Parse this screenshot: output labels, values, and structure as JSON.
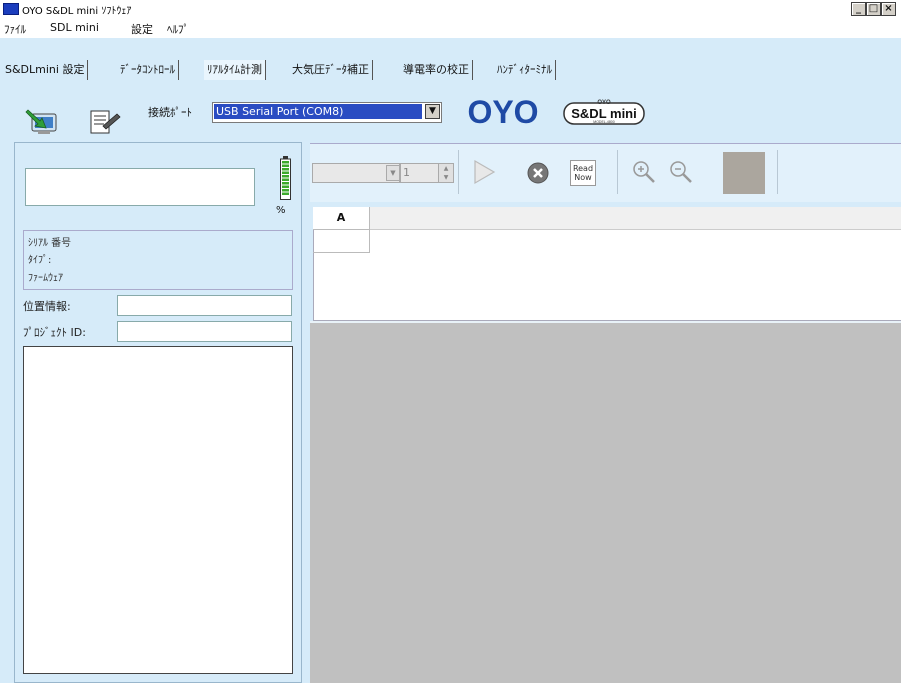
{
  "window": {
    "title": "OYO S&DL mini ｿﾌﾄｳｪｱ",
    "buttons": [
      "_",
      "□",
      "×"
    ]
  },
  "menu": {
    "items": [
      "ﾌｧｲﾙ",
      "SDL mini",
      "設定",
      "ﾍﾙﾌﾟ"
    ]
  },
  "tabs": {
    "items": [
      "S&DLmini 設定",
      "ﾃﾞｰﾀｺﾝﾄﾛｰﾙ",
      "ﾘｱﾙﾀｲﾑ計測",
      "大気圧ﾃﾞｰﾀ補正",
      "導電率の校正",
      "ﾊﾝﾃﾞｨﾀｰﾐﾅﾙ"
    ],
    "active_index": 2
  },
  "toolbar": {
    "port_label": "接続ﾎﾟｰﾄ",
    "port_value": "USB Serial Port (COM8)",
    "logo_oyo": "OYO",
    "logo_sdl": "S&DL mini",
    "logo_sdl_top": "OYO",
    "logo_sdl_model": "MODEL-4800"
  },
  "left_panel": {
    "battery_unit": "%",
    "info": {
      "serial_label": "ｼﾘｱﾙ 番号",
      "type_label": "ﾀｲﾌﾟ:",
      "firmware_label": "ﾌｧｰﾑｳｪｱ"
    },
    "location_label": "位置情報:",
    "project_label": "ﾌﾟﾛｼﾞｪｸﾄ ID:"
  },
  "right_panel": {
    "channel_value": "1",
    "read_now_label": "Read Now",
    "grid_column": "A"
  },
  "colors": {
    "background": "#d6ebf9",
    "selection": "#2a4cc2",
    "logo_blue": "#1f4aa5",
    "plot_gray": "#c0c0c0"
  }
}
